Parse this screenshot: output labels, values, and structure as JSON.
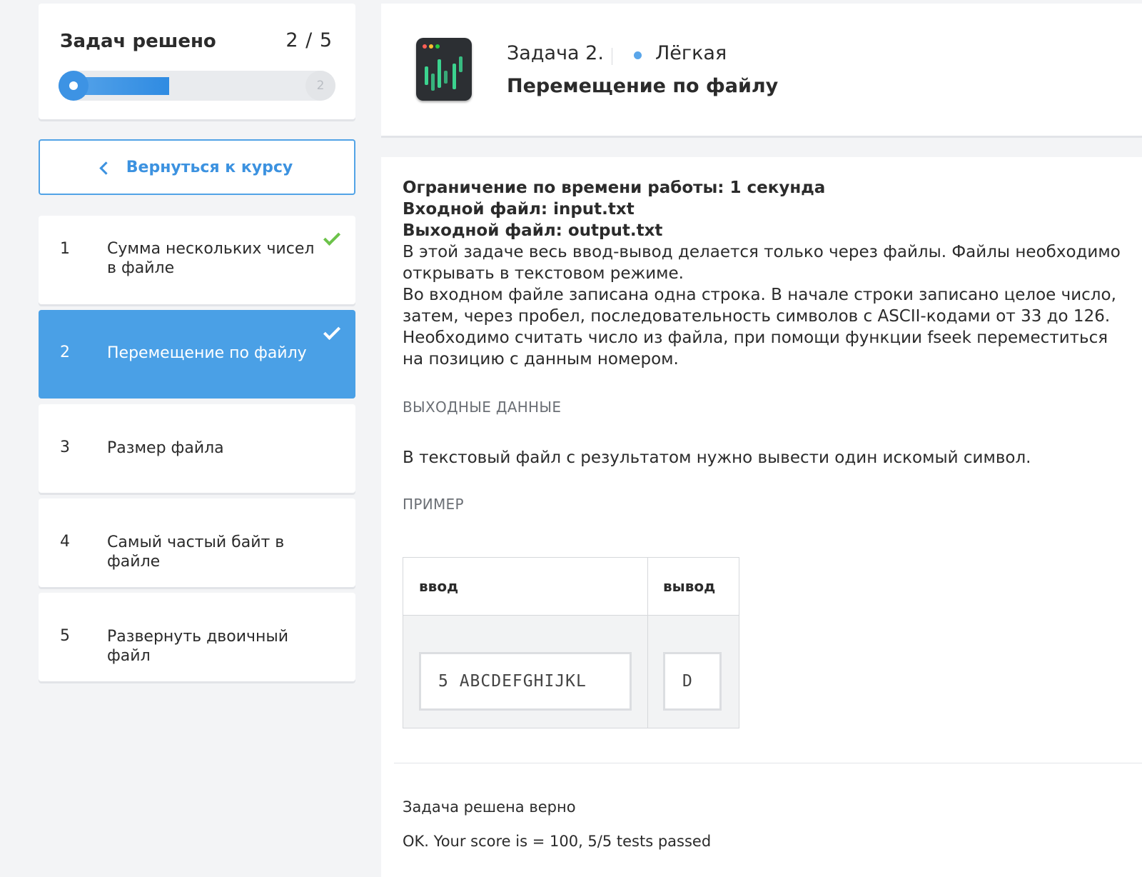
{
  "progress": {
    "title": "Задач решено",
    "count": "2 / 5",
    "fraction_solved": 0.4,
    "end_marker": "2"
  },
  "back_button": {
    "label": "Вернуться к курсу"
  },
  "tasks": [
    {
      "num": "1",
      "label": "Сумма нескольких чисел в файле",
      "solved": true
    },
    {
      "num": "2",
      "label": "Перемещение по файлу",
      "solved": true,
      "active": true
    },
    {
      "num": "3",
      "label": "Размер файла",
      "solved": false
    },
    {
      "num": "4",
      "label": "Самый частый байт в файле",
      "solved": false
    },
    {
      "num": "5",
      "label": "Развернуть двоичный файл",
      "solved": false
    }
  ],
  "header": {
    "icon": "terminal-app-icon",
    "task_number": "Задача 2.",
    "difficulty": "Лёгкая",
    "difficulty_color": "#5aa6ea",
    "title": "Перемещение по файлу"
  },
  "statement": {
    "time_limit": "Ограничение по времени работы: 1 секунда",
    "input_file": "Входной файл: input.txt",
    "output_file": "Выходной файл: output.txt",
    "p1": "В этой задаче весь ввод-вывод делается только через файлы. Файлы необходимо открывать в текстовом режиме.",
    "p2": "Во входном файле записана одна строка. В начале строки записано целое число, затем, через пробел, последовательность символов с ASCII-кодами от 33 до 126.",
    "p3": "Необходимо считать число из файла, при помощи функции fseek переместиться на позицию с данным номером."
  },
  "output_section": {
    "heading": "ВЫХОДНЫЕ ДАННЫЕ",
    "text": "В текстовый файл с результатом нужно вывести один искомый символ."
  },
  "example": {
    "heading": "ПРИМЕР",
    "input_header": "ввод",
    "output_header": "вывод",
    "input_value": "5 ABCDEFGHIJKL",
    "output_value": "D"
  },
  "result": {
    "status": "Задача решена верно",
    "score": "OK. Your score is = 100, 5/5 tests passed"
  },
  "colors": {
    "accent": "#4aa0e6",
    "check": "#6cc24a"
  }
}
